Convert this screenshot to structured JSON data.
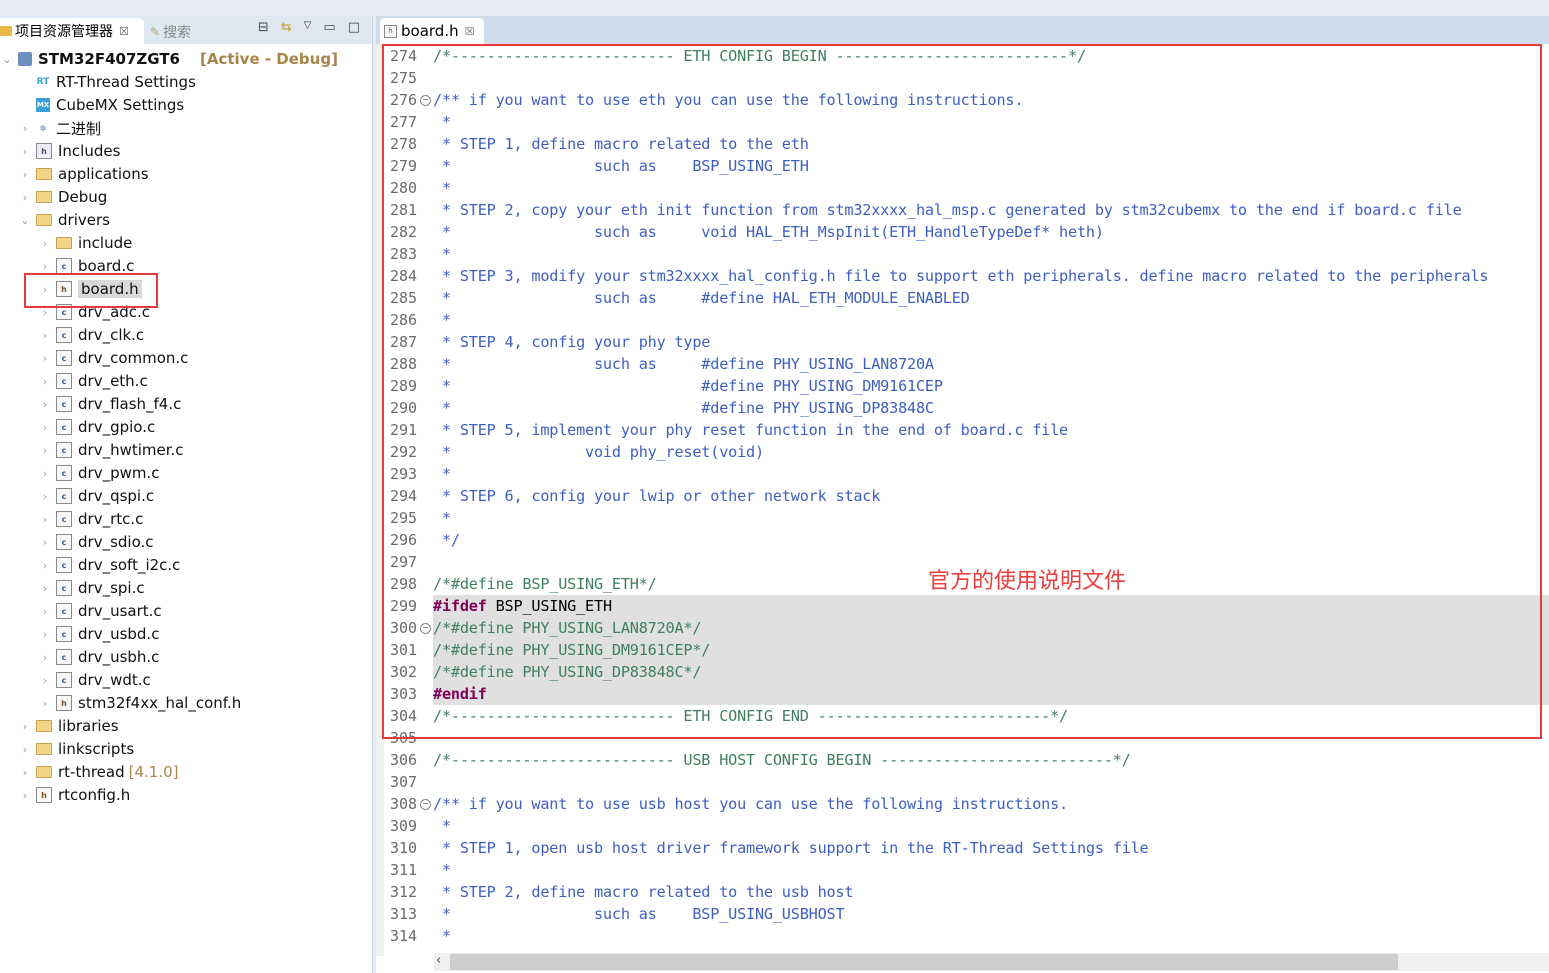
{
  "explorer": {
    "tab_label": "项目资源管理器",
    "tab_close": "☒",
    "search_tab_label": "搜索",
    "tools": [
      "collapse-all",
      "link-with-editor",
      "view-menu",
      "minimize",
      "maximize"
    ],
    "tree": [
      {
        "label": "STM32F407ZGT6",
        "tag": "[Active - Debug]",
        "level": 0,
        "expanded": true,
        "icon": "project-icon"
      },
      {
        "label": "RT-Thread Settings",
        "level": 1,
        "icon": "rt-icon",
        "leaf": true
      },
      {
        "label": "CubeMX Settings",
        "level": 1,
        "icon": "mx-icon",
        "leaf": true
      },
      {
        "label": "二进制",
        "level": 1,
        "icon": "binaries-icon"
      },
      {
        "label": "Includes",
        "level": 1,
        "icon": "includes-icon"
      },
      {
        "label": "applications",
        "level": 1,
        "icon": "folder-icon"
      },
      {
        "label": "Debug",
        "level": 1,
        "icon": "folder-icon"
      },
      {
        "label": "drivers",
        "level": 1,
        "icon": "folder-icon",
        "expanded": true
      },
      {
        "label": "include",
        "level": 2,
        "icon": "folder-icon"
      },
      {
        "label": "board.c",
        "level": 2,
        "icon": "c-file-icon"
      },
      {
        "label": "board.h",
        "level": 2,
        "icon": "h-file-icon",
        "selected": true
      },
      {
        "label": "drv_adc.c",
        "level": 2,
        "icon": "c-file-icon"
      },
      {
        "label": "drv_clk.c",
        "level": 2,
        "icon": "c-file-icon"
      },
      {
        "label": "drv_common.c",
        "level": 2,
        "icon": "c-file-icon"
      },
      {
        "label": "drv_eth.c",
        "level": 2,
        "icon": "c-file-icon"
      },
      {
        "label": "drv_flash_f4.c",
        "level": 2,
        "icon": "c-file-icon"
      },
      {
        "label": "drv_gpio.c",
        "level": 2,
        "icon": "c-file-icon"
      },
      {
        "label": "drv_hwtimer.c",
        "level": 2,
        "icon": "c-file-icon"
      },
      {
        "label": "drv_pwm.c",
        "level": 2,
        "icon": "c-file-icon"
      },
      {
        "label": "drv_qspi.c",
        "level": 2,
        "icon": "c-file-icon"
      },
      {
        "label": "drv_rtc.c",
        "level": 2,
        "icon": "c-file-icon"
      },
      {
        "label": "drv_sdio.c",
        "level": 2,
        "icon": "c-file-icon"
      },
      {
        "label": "drv_soft_i2c.c",
        "level": 2,
        "icon": "c-file-icon"
      },
      {
        "label": "drv_spi.c",
        "level": 2,
        "icon": "c-file-icon"
      },
      {
        "label": "drv_usart.c",
        "level": 2,
        "icon": "c-file-icon"
      },
      {
        "label": "drv_usbd.c",
        "level": 2,
        "icon": "c-file-icon"
      },
      {
        "label": "drv_usbh.c",
        "level": 2,
        "icon": "c-file-icon"
      },
      {
        "label": "drv_wdt.c",
        "level": 2,
        "icon": "c-file-icon"
      },
      {
        "label": "stm32f4xx_hal_conf.h",
        "level": 2,
        "icon": "h-file-icon"
      },
      {
        "label": "libraries",
        "level": 1,
        "icon": "folder-icon"
      },
      {
        "label": "linkscripts",
        "level": 1,
        "icon": "folder-icon"
      },
      {
        "label": "rt-thread",
        "tag": "[4.1.0]",
        "level": 1,
        "icon": "folder-icon"
      },
      {
        "label": "rtconfig.h",
        "level": 1,
        "icon": "h-file-icon"
      }
    ]
  },
  "editor": {
    "tab_label": "board.h",
    "tab_close": "☒",
    "annotation": "官方的使用说明文件",
    "annotation_color": "#ef3d3d",
    "highlight_color": "#e83a3a",
    "lines": [
      {
        "n": "274",
        "style": "com",
        "text": "/*------------------------- ETH CONFIG BEGIN --------------------------*/"
      },
      {
        "n": "275",
        "style": "com",
        "text": ""
      },
      {
        "n": "276",
        "style": "doc",
        "text": "/** if you want to use eth you can use the following instructions.",
        "fold": true
      },
      {
        "n": "277",
        "style": "doc",
        "text": " *"
      },
      {
        "n": "278",
        "style": "doc",
        "text": " * STEP 1, define macro related to the eth"
      },
      {
        "n": "279",
        "style": "doc",
        "text": " *                such as    BSP_USING_ETH"
      },
      {
        "n": "280",
        "style": "doc",
        "text": " *"
      },
      {
        "n": "281",
        "style": "doc",
        "text": " * STEP 2, copy your eth init function from stm32xxxx_hal_msp.c generated by stm32cubemx to the end if board.c file"
      },
      {
        "n": "282",
        "style": "doc",
        "text": " *                such as     void HAL_ETH_MspInit(ETH_HandleTypeDef* heth)"
      },
      {
        "n": "283",
        "style": "doc",
        "text": " *"
      },
      {
        "n": "284",
        "style": "doc",
        "text": " * STEP 3, modify your stm32xxxx_hal_config.h file to support eth peripherals. define macro related to the peripherals"
      },
      {
        "n": "285",
        "style": "doc",
        "text": " *                such as     #define HAL_ETH_MODULE_ENABLED"
      },
      {
        "n": "286",
        "style": "doc",
        "text": " *"
      },
      {
        "n": "287",
        "style": "doc",
        "text": " * STEP 4, config your phy type"
      },
      {
        "n": "288",
        "style": "doc",
        "text": " *                such as     #define PHY_USING_LAN8720A"
      },
      {
        "n": "289",
        "style": "doc",
        "text": " *                            #define PHY_USING_DM9161CEP"
      },
      {
        "n": "290",
        "style": "doc",
        "text": " *                            #define PHY_USING_DP83848C"
      },
      {
        "n": "291",
        "style": "doc",
        "text": " * STEP 5, implement your phy reset function in the end of board.c file"
      },
      {
        "n": "292",
        "style": "doc",
        "text": " *               void phy_reset(void)"
      },
      {
        "n": "293",
        "style": "doc",
        "text": " *"
      },
      {
        "n": "294",
        "style": "doc",
        "text": " * STEP 6, config your lwip or other network stack"
      },
      {
        "n": "295",
        "style": "doc",
        "text": " *"
      },
      {
        "n": "296",
        "style": "doc",
        "text": " */"
      },
      {
        "n": "297",
        "style": "com",
        "text": ""
      },
      {
        "n": "298",
        "style": "com",
        "text": "/*#define BSP_USING_ETH*/"
      },
      {
        "n": "299",
        "style": "kw",
        "kw": "#ifdef",
        "rest": " BSP_USING_ETH",
        "inactive": true
      },
      {
        "n": "300",
        "style": "com",
        "text": "/*#define PHY_USING_LAN8720A*/",
        "fold": true,
        "inactive": true
      },
      {
        "n": "301",
        "style": "com",
        "text": "/*#define PHY_USING_DM9161CEP*/",
        "inactive": true
      },
      {
        "n": "302",
        "style": "com",
        "text": "/*#define PHY_USING_DP83848C*/",
        "inactive": true
      },
      {
        "n": "303",
        "style": "kw",
        "kw": "#endif",
        "rest": "",
        "inactive": true
      },
      {
        "n": "304",
        "style": "com",
        "text": "/*------------------------- ETH CONFIG END --------------------------*/"
      },
      {
        "n": "305",
        "style": "com",
        "text": ""
      },
      {
        "n": "306",
        "style": "com",
        "text": "/*------------------------- USB HOST CONFIG BEGIN --------------------------*/"
      },
      {
        "n": "307",
        "style": "com",
        "text": ""
      },
      {
        "n": "308",
        "style": "doc",
        "text": "/** if you want to use usb host you can use the following instructions.",
        "fold": true
      },
      {
        "n": "309",
        "style": "doc",
        "text": " *"
      },
      {
        "n": "310",
        "style": "doc",
        "text": " * STEP 1, open usb host driver framework support in the RT-Thread Settings file"
      },
      {
        "n": "311",
        "style": "doc",
        "text": " *"
      },
      {
        "n": "312",
        "style": "doc",
        "text": " * STEP 2, define macro related to the usb host"
      },
      {
        "n": "313",
        "style": "doc",
        "text": " *                such as    BSP_USING_USBHOST"
      },
      {
        "n": "314",
        "style": "doc",
        "text": " *"
      }
    ]
  }
}
